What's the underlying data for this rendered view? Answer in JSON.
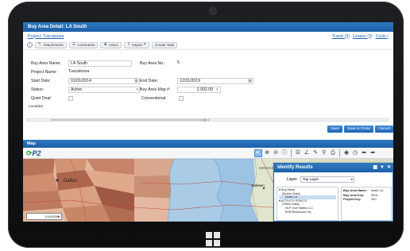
{
  "window": {
    "title": "Buy Area Detail: LA South"
  },
  "breadcrumb": {
    "project_link": "Project: Tuscaloosa"
  },
  "top_links": [
    "Tracts (3)",
    "Leases (3)",
    "Costs ("
  ],
  "toolbar": {
    "info_label": "i",
    "buttons": [
      "Attachments",
      "Comments",
      "Users",
      "Import",
      "Create Task"
    ]
  },
  "form": {
    "buy_area_name_label": "Buy Area Name:",
    "buy_area_name_value": "LA South",
    "buy_area_no_label": "Buy Area No.:",
    "buy_area_no_value": "5",
    "project_name_label": "Project Name:",
    "project_name_value": "Tuscaloosa",
    "start_date_label": "Start Date:",
    "start_date_value": "01/01/2014",
    "end_date_label": "End Date:",
    "end_date_value": "12/31/2019",
    "status_label": "Status:",
    "status_value": "Active",
    "buy_area_map_label": "Buy Area Map #:",
    "buy_area_map_value": "2,002.00",
    "quiet_deal_label": "Quiet Deal:",
    "conventional_label": "Conventional:",
    "location_label": "Location"
  },
  "actions": {
    "save": "Save",
    "save_close": "Save & Close",
    "cancel": "Cancel"
  },
  "map": {
    "section_title": "Map",
    "logo": "P2",
    "scale_value": "1:4915282",
    "labels": {
      "dallas": "Dallas",
      "jackson": "Jackson",
      "mississippi": "MISSISSIPPI"
    }
  },
  "identify": {
    "title": "Identify Results",
    "layer_label": "Layer:",
    "layer_value": "Top Layer",
    "tree": [
      "Buy Areas",
      "(Broker Data)",
      "North LA",
      "ACTIVITY POINTS",
      "(Yellim Data)",
      "HLP Gulf States LLC",
      "BXB Resources Inc"
    ],
    "details": [
      {
        "label": "Buy Area Name:",
        "value": "North LA"
      },
      {
        "label": "Buy Area Key:",
        "value": "2001"
      },
      {
        "label": "Project Key:",
        "value": "200"
      }
    ]
  }
}
